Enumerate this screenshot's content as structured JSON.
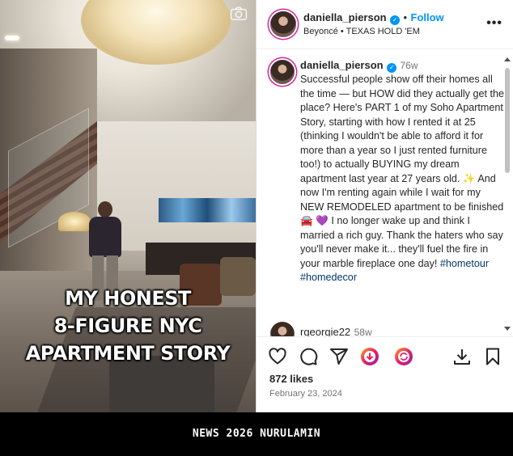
{
  "video": {
    "overlay_lines": [
      "MY HONEST",
      "8-FIGURE NYC",
      "APARTMENT STORY"
    ]
  },
  "header": {
    "username": "daniella_pierson",
    "follow_label": "Follow",
    "separator": "•",
    "audio_artist": "Beyoncé",
    "audio_track": "TEXAS HOLD 'EM",
    "more_label": "•••"
  },
  "caption": {
    "username": "daniella_pierson",
    "time": "76w",
    "text": "Successful people show off their homes all the time — but HOW did they actually get the place? Here's PART 1 of my Soho Apartment Story, starting with how I rented it at 25 (thinking I wouldn't be able to afford it for more than a year so I just rented furniture too!) to actually BUYING my dream apartment last year at 27 years old. ✨ And now I'm renting again while I wait for my NEW REMODELED apartment to be finished 🚘 💜 I no longer wake up and think I married a rich guy. Thank the haters who say you'll never make it... they'll fuel the fire in your marble fireplace one day!",
    "hashtag1": "#hometour",
    "hashtag2": "#homedecor"
  },
  "comment": {
    "username": "rgeorgie22",
    "time": "58w"
  },
  "actions": {
    "likes": "872 likes",
    "date": "February 23, 2024"
  },
  "footer": {
    "text": "NEWS 2026 NURULAMIN"
  },
  "colors": {
    "accent": "#0095f6",
    "hashtag": "#00376b",
    "muted": "#737373",
    "story_ring": "#d6249f"
  }
}
